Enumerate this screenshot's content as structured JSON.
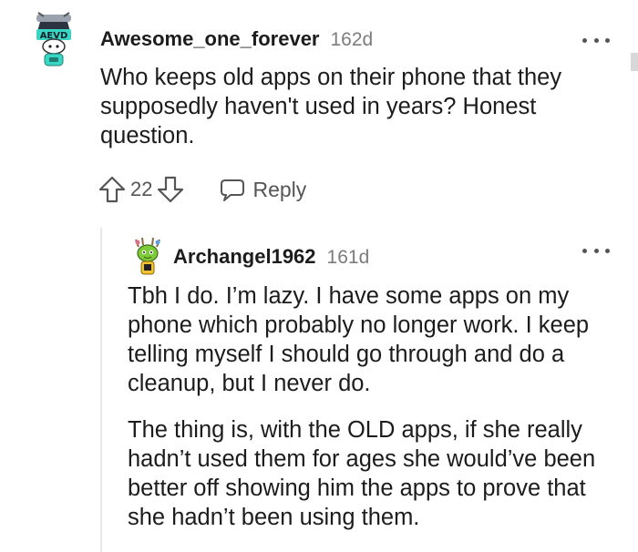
{
  "comments": [
    {
      "author": "Awesome_one_forever",
      "age": "162d",
      "body": [
        "Who keeps old apps on their phone that they supposedly haven't used in years? Honest question."
      ],
      "score": "22",
      "reply_label": "Reply",
      "more_icon": "more-options-icon"
    },
    {
      "author": "Archangel1962",
      "age": "161d",
      "body": [
        "Tbh I do. I’m lazy. I have some apps on my phone which probably no longer work. I keep telling myself I should go through and do a cleanup, but I never do.",
        "The thing is, with the OLD apps, if she really hadn’t used them for ages she would’ve been better off showing him the apps to prove that she hadn’t been using them."
      ],
      "more_icon": "more-options-icon"
    }
  ],
  "colors": {
    "text": "#1c1c1c",
    "meta": "#7c7c7c",
    "icon": "#555555",
    "thread_line": "#e8e8e8",
    "avatar1_accent": "#3ad6c4",
    "avatar2_accent": "#7ecb3a"
  }
}
